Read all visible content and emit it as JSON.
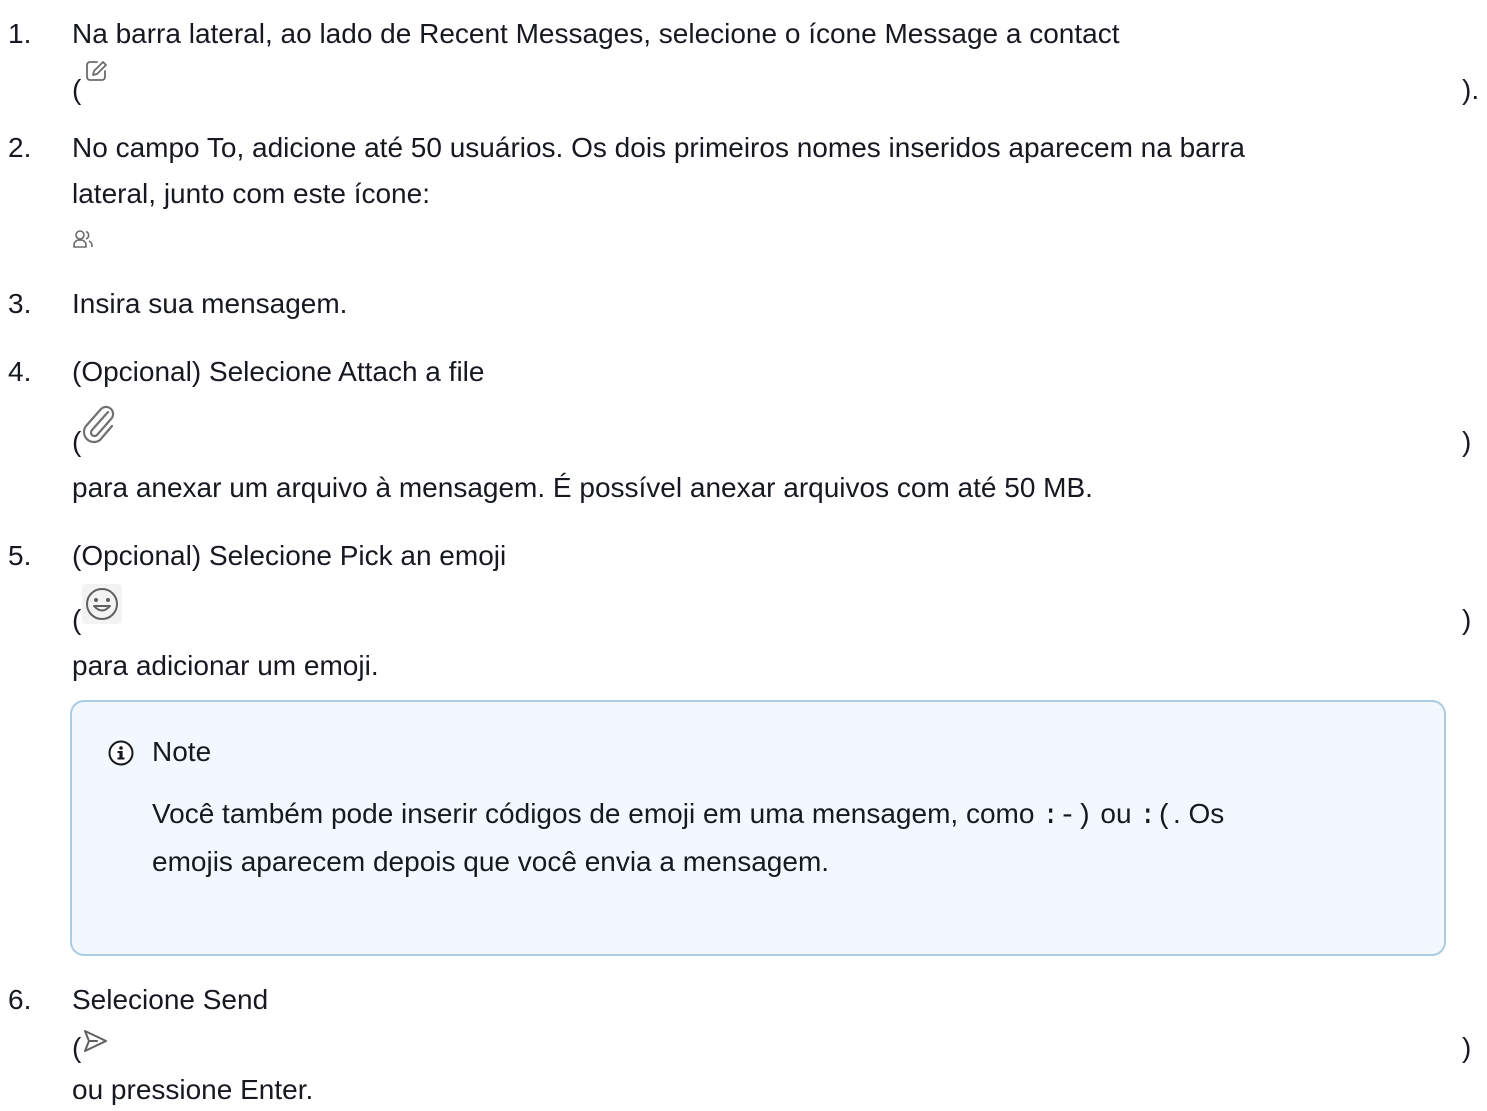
{
  "steps": [
    {
      "num": "1.",
      "line1": "Na barra lateral, ao lado de Recent Messages, selecione o ícone Message a contact",
      "open": "(",
      "close": ")."
    },
    {
      "num": "2.",
      "line1": "No campo To, adicione até 50 usuários. Os dois primeiros nomes inseridos aparecem na barra",
      "line2": "lateral, junto com este ícone:"
    },
    {
      "num": "3.",
      "line1": "Insira sua mensagem."
    },
    {
      "num": "4.",
      "line1": "(Opcional) Selecione Attach a file",
      "open": "(",
      "close": ")",
      "line3": "para anexar um arquivo à mensagem. É possível anexar arquivos com até 50 MB."
    },
    {
      "num": "5.",
      "line1": "(Opcional) Selecione Pick an emoji",
      "open": "(",
      "close": ")",
      "line3": "para adicionar um emoji."
    },
    {
      "num": "6.",
      "line1": "Selecione Send",
      "open": "(",
      "close": ")",
      "line3": "ou pressione Enter."
    }
  ],
  "note": {
    "title": "Note",
    "text_a": "Você também pode inserir códigos de emoji em uma mensagem, como ",
    "code1": ":-)",
    "text_b": " ou ",
    "code2": ":(",
    "text_c": ". Os",
    "text_d": "emojis aparecem depois que você envia a mensagem."
  },
  "icons": [
    "compose-icon",
    "group-icon",
    "paperclip-icon",
    "emoji-icon",
    "send-icon",
    "info-icon"
  ]
}
